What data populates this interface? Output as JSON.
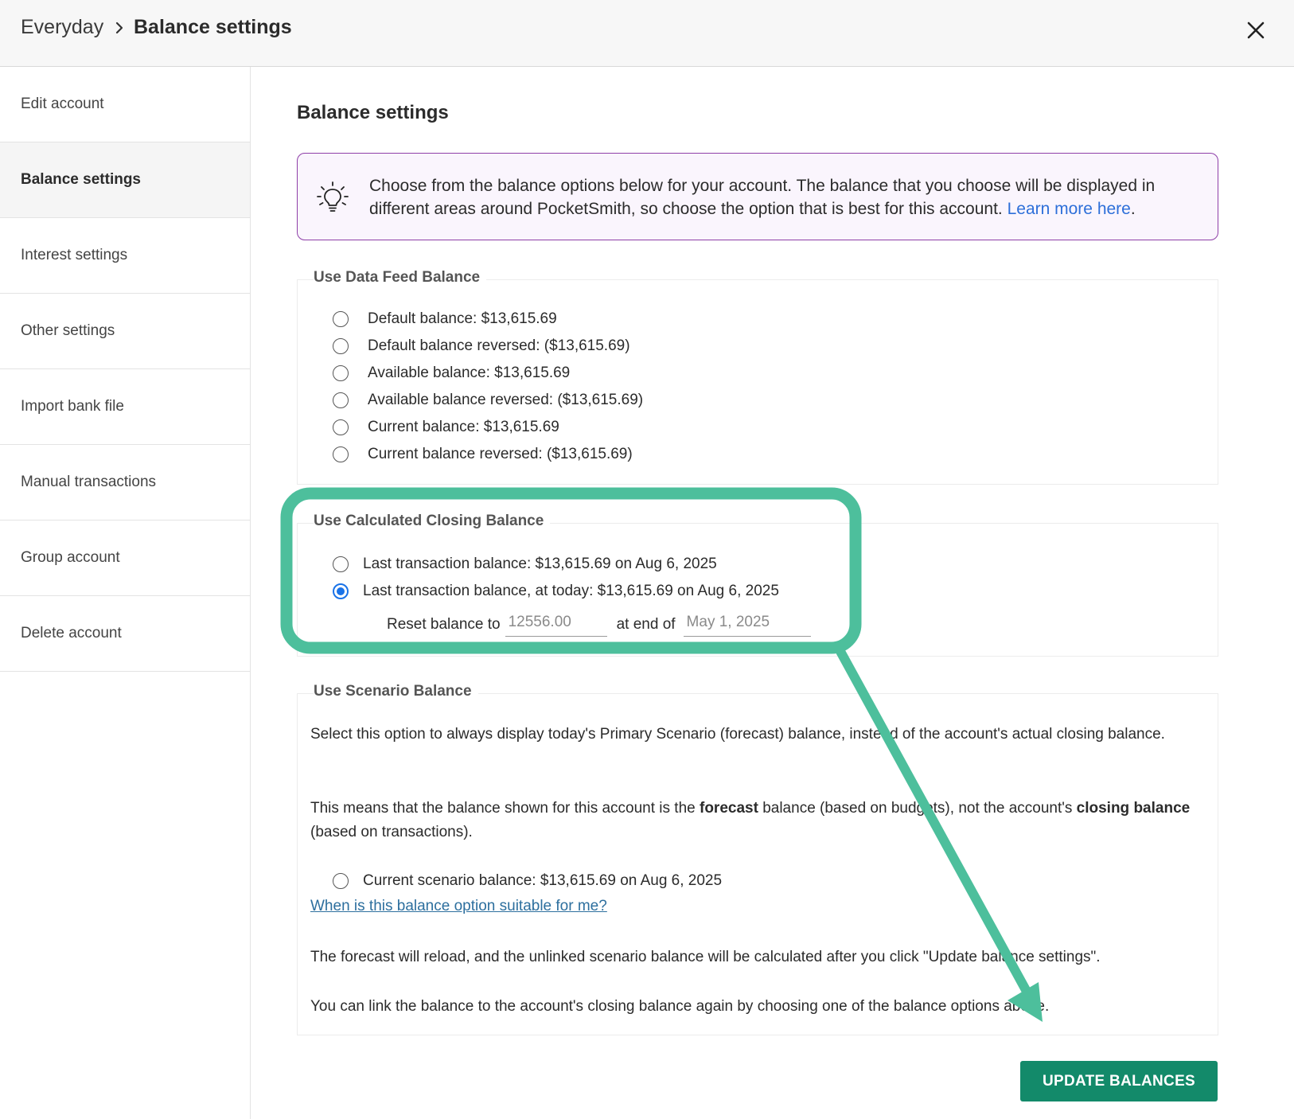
{
  "header": {
    "breadcrumb_root": "Everyday",
    "breadcrumb_current": "Balance settings"
  },
  "sidebar": {
    "items": [
      {
        "label": "Edit account"
      },
      {
        "label": "Balance settings",
        "active": true
      },
      {
        "label": "Interest settings"
      },
      {
        "label": "Other settings"
      },
      {
        "label": "Import bank file"
      },
      {
        "label": "Manual transactions"
      },
      {
        "label": "Group account"
      },
      {
        "label": "Delete account"
      }
    ]
  },
  "main": {
    "title": "Balance settings",
    "info": {
      "text": "Choose from the balance options below for your account. The balance that you choose will be displayed in different areas around PocketSmith, so choose the option that is best for this account.",
      "link": "Learn more here",
      "suffix": "."
    },
    "data_feed": {
      "legend": "Use Data Feed Balance",
      "options": [
        "Default balance: $13,615.69",
        "Default balance reversed: ($13,615.69)",
        "Available balance: $13,615.69",
        "Available balance reversed: ($13,615.69)",
        "Current balance: $13,615.69",
        "Current balance reversed: ($13,615.69)"
      ]
    },
    "calculated": {
      "legend": "Use Calculated Closing Balance",
      "options": [
        "Last transaction balance: $13,615.69 on Aug 6, 2025",
        "Last transaction balance, at today: $13,615.69 on Aug 6, 2025"
      ],
      "selected_index": 1,
      "reset_label": "Reset balance to",
      "reset_value": "12556.00",
      "end_label": "at end of",
      "end_date": "May 1, 2025"
    },
    "scenario": {
      "legend": "Use Scenario Balance",
      "para1": "Select this option to always display today's Primary Scenario (forecast) balance, instead of the account's actual closing balance.",
      "para2_pre": "This means that the balance shown for this account is the ",
      "para2_bold1": "forecast",
      "para2_mid": " balance (based on budgets), not the account's ",
      "para2_bold2": "closing balance",
      "para2_post": " (based on transactions).",
      "option": "Current scenario balance: $13,615.69 on Aug 6, 2025",
      "faq_link": "When is this balance option suitable for me?",
      "para3": "The forecast will reload, and the unlinked scenario balance will be calculated after you click \"Update balance settings\".",
      "para4": "You can link the balance to the account's closing balance again by choosing one of the balance options above."
    },
    "update_button": "UPDATE BALANCES"
  },
  "colors": {
    "highlight": "#4dbf9c",
    "button": "#138a6a",
    "link": "#2d6fd9",
    "radio_selected": "#1a73e8",
    "info_border": "#8e3fa8"
  },
  "icons": [
    "chevron-right-icon",
    "close-icon",
    "lightbulb-icon",
    "annotation-arrow"
  ]
}
